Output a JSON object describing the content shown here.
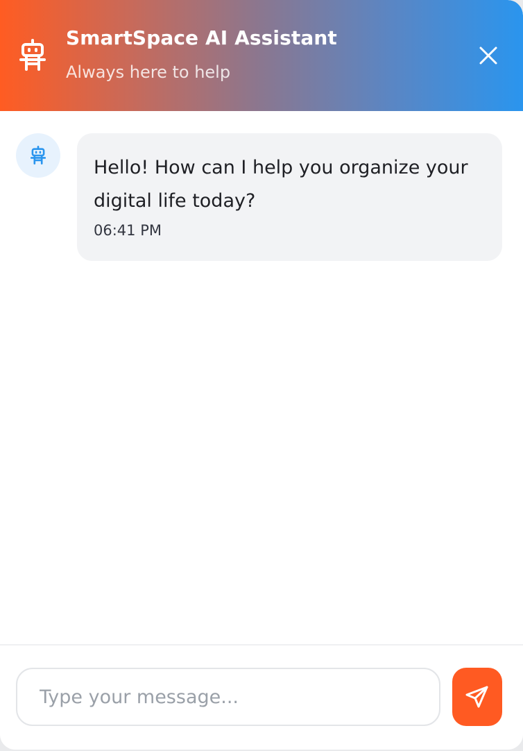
{
  "header": {
    "title": "SmartSpace AI Assistant",
    "subtitle": "Always here to help",
    "icon": "robot-icon",
    "close_icon": "close-icon",
    "gradient_start": "#ff5c22",
    "gradient_end": "#2a95ee"
  },
  "messages": [
    {
      "sender": "assistant",
      "avatar_icon": "robot-icon",
      "text": "Hello! How can I help you organize your digital life today?",
      "time": "06:41 PM"
    }
  ],
  "composer": {
    "placeholder": "Type your message...",
    "value": "",
    "send_icon": "send-icon",
    "send_color": "#ff5a22"
  },
  "colors": {
    "bubble_bg": "#f2f3f5",
    "avatar_bg": "#e7f2fd",
    "accent_blue": "#2a95ee"
  }
}
